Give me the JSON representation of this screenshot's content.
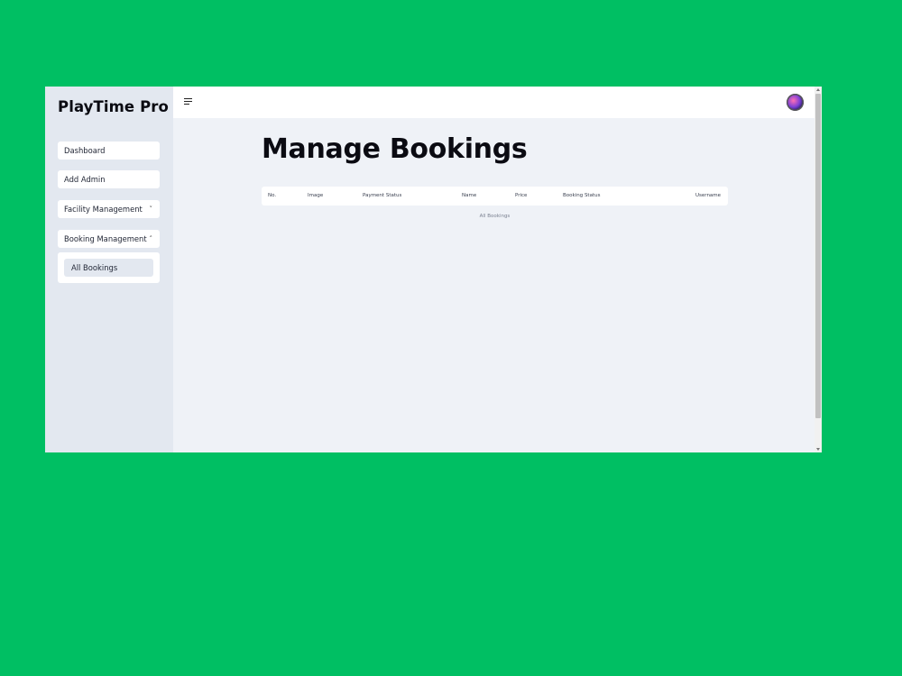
{
  "sidebar": {
    "brand": "PlayTime Pro",
    "items": [
      {
        "label": "Dashboard"
      },
      {
        "label": "Add Admin"
      },
      {
        "label": "Facility Management",
        "chevron": "˅"
      },
      {
        "label": "Booking Management",
        "chevron": "˄"
      }
    ],
    "submenu": [
      {
        "label": "All Bookings"
      }
    ]
  },
  "topbar": {
    "menu_icon": "hamburger-icon",
    "avatar_icon": "avatar-image"
  },
  "main": {
    "title": "Manage Bookings",
    "table": {
      "columns": [
        "No.",
        "Image",
        "Payment Status",
        "Name",
        "Price",
        "Booking Status",
        "Username"
      ],
      "caption": "All Bookings"
    }
  },
  "colors": {
    "background": "#00bf63",
    "sidebar": "#e3e8f0",
    "main": "#eff2f7"
  }
}
